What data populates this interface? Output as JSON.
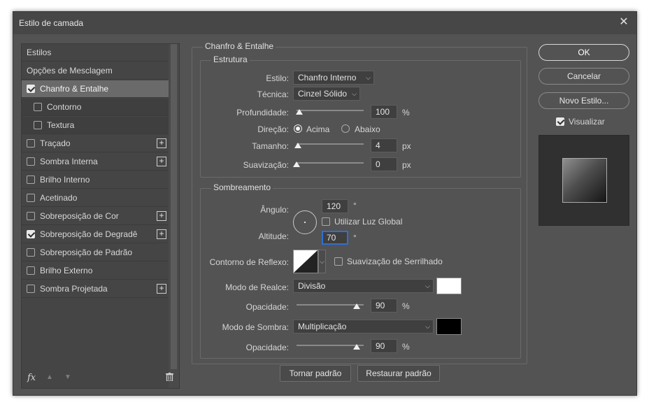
{
  "window": {
    "title": "Estilo de camada"
  },
  "styles_list": {
    "header_estilos": "Estilos",
    "header_opcoes": "Opções de Mesclagem",
    "items": [
      {
        "label": "Chanfro & Entalhe",
        "checked": true,
        "selected": true,
        "plus": false
      },
      {
        "label": "Contorno",
        "checked": false,
        "sub": true,
        "plus": false
      },
      {
        "label": "Textura",
        "checked": false,
        "sub": true,
        "plus": false
      },
      {
        "label": "Traçado",
        "checked": false,
        "plus": true
      },
      {
        "label": "Sombra Interna",
        "checked": false,
        "plus": true
      },
      {
        "label": "Brilho Interno",
        "checked": false,
        "plus": false
      },
      {
        "label": "Acetinado",
        "checked": false,
        "plus": false
      },
      {
        "label": "Sobreposição de Cor",
        "checked": false,
        "plus": true
      },
      {
        "label": "Sobreposição de Degradê",
        "checked": true,
        "plus": true
      },
      {
        "label": "Sobreposição de Padrão",
        "checked": false,
        "plus": false
      },
      {
        "label": "Brilho Externo",
        "checked": false,
        "plus": false
      },
      {
        "label": "Sombra Projetada",
        "checked": false,
        "plus": true
      }
    ],
    "fx_label": "fx"
  },
  "bevel": {
    "section_title": "Chanfro & Entalhe",
    "structure": {
      "title": "Estrutura",
      "estilo_label": "Estilo:",
      "estilo_value": "Chanfro Interno",
      "tecnica_label": "Técnica:",
      "tecnica_value": "Cinzel Sólido",
      "profundidade_label": "Profundidade:",
      "profundidade_value": "100",
      "profundidade_unit": "%",
      "profundidade_level": 0.04,
      "direcao_label": "Direção:",
      "direcao_acima": "Acima",
      "direcao_abaixo": "Abaixo",
      "tamanho_label": "Tamanho:",
      "tamanho_value": "4",
      "tamanho_unit": "px",
      "tamanho_level": 0.02,
      "suavizacao_label": "Suavização:",
      "suavizacao_value": "0",
      "suavizacao_unit": "px",
      "suavizacao_level": 0.0
    },
    "shading": {
      "title": "Sombreamento",
      "angulo_label": "Ângulo:",
      "angulo_value": "120",
      "angulo_unit": "°",
      "luz_global_label": "Utilizar Luz Global",
      "altitude_label": "Altitude:",
      "altitude_value": "70",
      "altitude_unit": "°",
      "contorno_label": "Contorno de Reflexo:",
      "suavizacao_serrilhado_label": "Suavização de Serrilhado",
      "modo_realce_label": "Modo de Realce:",
      "modo_realce_value": "Divisão",
      "realce_color": "#ffffff",
      "opacidade1_label": "Opacidade:",
      "opacidade1_value": "90",
      "opacidade1_unit": "%",
      "opacidade1_level": 0.9,
      "modo_sombra_label": "Modo de Sombra:",
      "modo_sombra_value": "Multiplicação",
      "sombra_color": "#000000",
      "opacidade2_label": "Opacidade:",
      "opacidade2_value": "90",
      "opacidade2_unit": "%",
      "opacidade2_level": 0.9
    },
    "tornar_padrao": "Tornar padrão",
    "restaurar_padrao": "Restaurar padrão"
  },
  "actions": {
    "ok": "OK",
    "cancelar": "Cancelar",
    "novo_estilo": "Novo Estilo...",
    "visualizar": "Visualizar"
  }
}
